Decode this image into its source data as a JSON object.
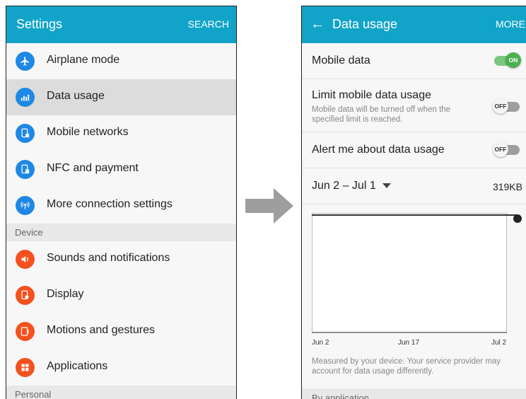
{
  "left": {
    "title": "Settings",
    "search": "SEARCH",
    "items": [
      {
        "label": "Airplane mode",
        "icon": "airplane-icon",
        "color": "#1e88e5"
      },
      {
        "label": "Data usage",
        "icon": "data-usage-icon",
        "color": "#1e88e5",
        "selected": true
      },
      {
        "label": "Mobile networks",
        "icon": "mobile-networks-icon",
        "color": "#1e88e5"
      },
      {
        "label": "NFC and payment",
        "icon": "nfc-icon",
        "color": "#1e88e5"
      },
      {
        "label": "More connection settings",
        "icon": "more-connection-icon",
        "color": "#1e88e5"
      }
    ],
    "section_device": "Device",
    "device_items": [
      {
        "label": "Sounds and notifications",
        "icon": "sound-icon",
        "color": "#f4511e"
      },
      {
        "label": "Display",
        "icon": "display-icon",
        "color": "#f4511e"
      },
      {
        "label": "Motions and gestures",
        "icon": "motions-icon",
        "color": "#f4511e"
      },
      {
        "label": "Applications",
        "icon": "applications-icon",
        "color": "#f4511e"
      }
    ],
    "section_personal": "Personal"
  },
  "right": {
    "title": "Data usage",
    "more": "MORE",
    "mobile_data": {
      "label": "Mobile data",
      "state": "ON"
    },
    "limit": {
      "label": "Limit mobile data usage",
      "sub": "Mobile data will be turned off when the specified limit is reached.",
      "state": "OFF"
    },
    "alert": {
      "label": "Alert me about data usage",
      "state": "OFF"
    },
    "cycle": {
      "range": "Jun 2 – Jul 1",
      "amount": "319KB"
    },
    "chart_labels": [
      "Jun 2",
      "Jun 17",
      "Jul 2"
    ],
    "note": "Measured by your device. Your service provider may account for data usage differently.",
    "by_app": "By application"
  },
  "colors": {
    "accent": "#12a4c8",
    "toggle_on": "#4caf50",
    "arrow": "#9e9e9e"
  }
}
